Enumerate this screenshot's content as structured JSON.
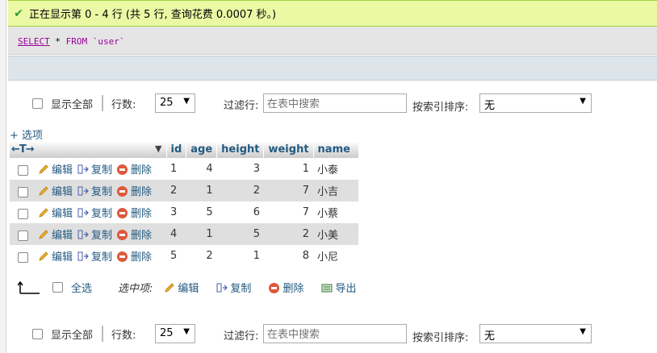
{
  "status": {
    "message": "正在显示第 0 - 4 行 (共 5 行, 查询花费 0.0007 秒。)"
  },
  "sql": {
    "select": "SELECT",
    "star": "*",
    "from": "FROM",
    "table": "`user`"
  },
  "nav_top": {
    "show_all": "显示全部",
    "rows_label": "行数:",
    "rows_value": "25",
    "filter_label": "过滤行:",
    "filter_placeholder": "在表中搜索",
    "sort_label": "按索引排序:",
    "sort_value": "无"
  },
  "nav_bottom": {
    "show_all": "显示全部",
    "rows_label": "行数:",
    "rows_value": "25",
    "filter_label": "过滤行:",
    "filter_placeholder": "在表中搜索",
    "sort_label": "按索引排序:",
    "sort_value": "无"
  },
  "options_link": "+ 选项",
  "table": {
    "nav_arrows": "←T→",
    "columns": [
      "id",
      "age",
      "height",
      "weight",
      "name"
    ],
    "rows": [
      {
        "id": "1",
        "age": "4",
        "height": "3",
        "weight": "1",
        "name": "小泰"
      },
      {
        "id": "2",
        "age": "1",
        "height": "2",
        "weight": "7",
        "name": "小吉"
      },
      {
        "id": "3",
        "age": "5",
        "height": "6",
        "weight": "7",
        "name": "小蔡"
      },
      {
        "id": "4",
        "age": "1",
        "height": "5",
        "weight": "2",
        "name": "小美"
      },
      {
        "id": "5",
        "age": "2",
        "height": "1",
        "weight": "8",
        "name": "小尼"
      }
    ],
    "row_actions": {
      "edit": "编辑",
      "copy": "复制",
      "delete": "删除"
    }
  },
  "bulk": {
    "check_all": "全选",
    "with_selected": "选中项:",
    "edit": "编辑",
    "copy": "复制",
    "delete": "删除",
    "export": "导出"
  },
  "colors": {
    "success_bg": "#ebf8a4",
    "link": "#235a81",
    "delete_icon": "#e0573b",
    "row_alt": "#dfdfdf"
  }
}
